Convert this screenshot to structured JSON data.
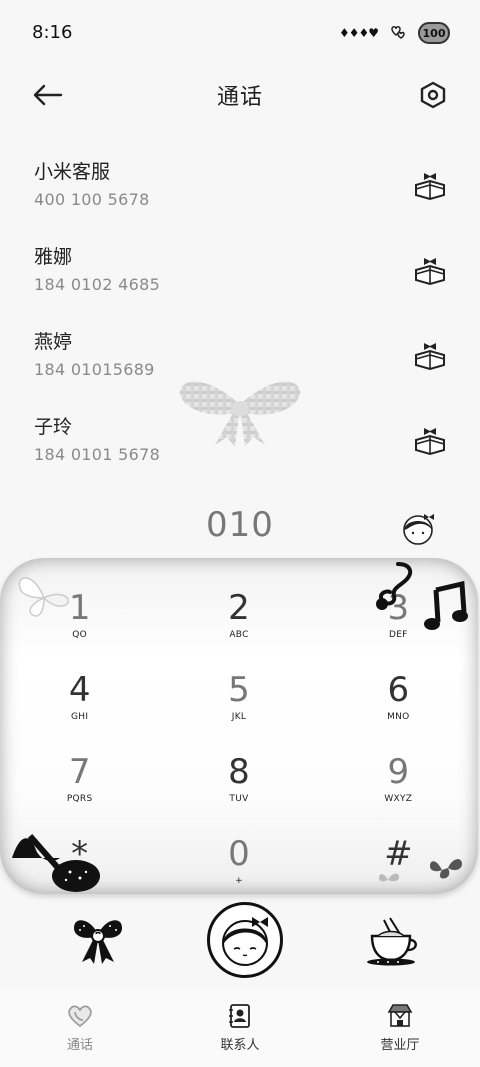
{
  "status_bar": {
    "time": "8:16",
    "decoration": "♦♦♦♥",
    "battery": "100"
  },
  "header": {
    "title": "通话",
    "back_icon": "arrow-left-icon",
    "settings_icon": "hexagon-settings-icon"
  },
  "contacts": [
    {
      "name": "小米客服",
      "number": "400 100 5678"
    },
    {
      "name": "雅娜",
      "number": "184 0102 4685"
    },
    {
      "name": "燕婷",
      "number": "184 01015689"
    },
    {
      "name": "子玲",
      "number": "184 0101 5678"
    }
  ],
  "dialer": {
    "display": "010",
    "keys": [
      {
        "digit": "1",
        "letters": "QO"
      },
      {
        "digit": "2",
        "letters": "ABC"
      },
      {
        "digit": "3",
        "letters": "DEF"
      },
      {
        "digit": "4",
        "letters": "GHI"
      },
      {
        "digit": "5",
        "letters": "JKL"
      },
      {
        "digit": "6",
        "letters": "MNO"
      },
      {
        "digit": "7",
        "letters": "PQRS"
      },
      {
        "digit": "8",
        "letters": "TUV"
      },
      {
        "digit": "9",
        "letters": "WXYZ"
      },
      {
        "digit": "*",
        "letters": ","
      },
      {
        "digit": "0",
        "letters": "+"
      },
      {
        "digit": "#",
        "letters": ""
      }
    ]
  },
  "bottom_nav": [
    {
      "label": "通话",
      "icon": "phone-heart-icon"
    },
    {
      "label": "联系人",
      "icon": "contacts-book-icon"
    },
    {
      "label": "营业厅",
      "icon": "store-icon"
    }
  ]
}
